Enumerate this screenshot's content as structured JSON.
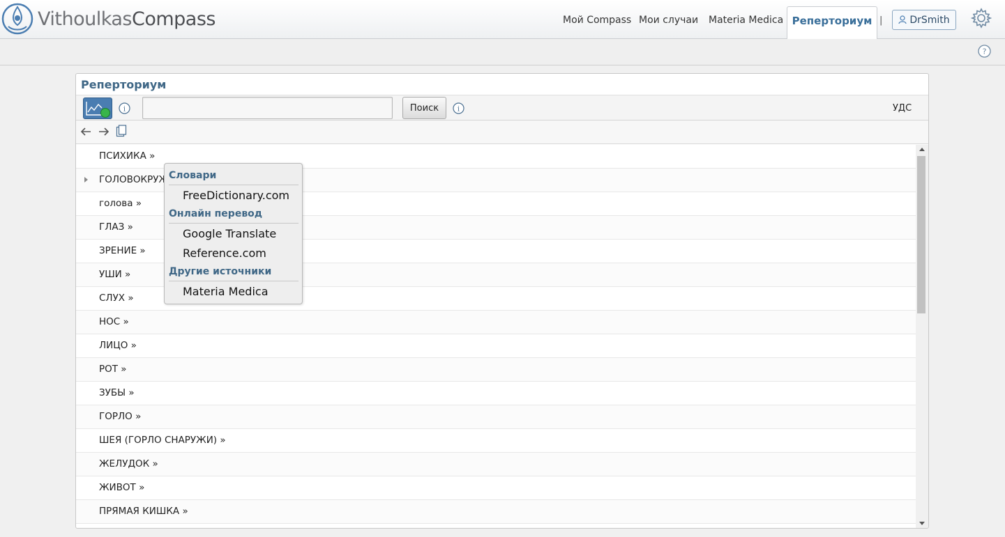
{
  "header": {
    "logo_light": "Vithoulkas",
    "logo_bold": "Compass",
    "nav": [
      "Мой Compass",
      "Мои случаи",
      "Materia Medica"
    ],
    "nav_active": "Реперториум",
    "separator": "|",
    "user": "DrSmith"
  },
  "panel": {
    "title": "Реперториум",
    "search_value": "",
    "search_button": "Поиск",
    "uds": "УДС"
  },
  "chapters": [
    "ПСИХИКА »",
    "ГОЛОВОКРУЖ",
    "голова »",
    "ГЛАЗ »",
    "ЗРЕНИЕ »",
    "УШИ »",
    "СЛУХ »",
    "НОС »",
    "ЛИЦО »",
    "РОТ »",
    "ЗУБЫ »",
    "ГОРЛО »",
    "ШЕЯ (ГОРЛО СНАРУЖИ) »",
    "ЖЕЛУДОК »",
    "ЖИВОТ »",
    "ПРЯМАЯ КИШКА »"
  ],
  "context_menu": {
    "sections": [
      {
        "heading": "Словари",
        "items": [
          "FreeDictionary.com"
        ]
      },
      {
        "heading": "Онлайн перевод",
        "items": [
          "Google Translate",
          "Reference.com"
        ]
      },
      {
        "heading": "Другие источники",
        "items": [
          "Materia Medica"
        ]
      }
    ]
  },
  "icons": [
    "logo-icon",
    "user-icon",
    "gear-icon",
    "help-icon",
    "chart-icon",
    "info-icon",
    "back-arrow-icon",
    "forward-arrow-icon",
    "copy-icon",
    "expand-icon"
  ],
  "colors": {
    "accent": "#3f6786",
    "active_tab": "#3a6f9a",
    "chart_button": "#4a7db1"
  }
}
